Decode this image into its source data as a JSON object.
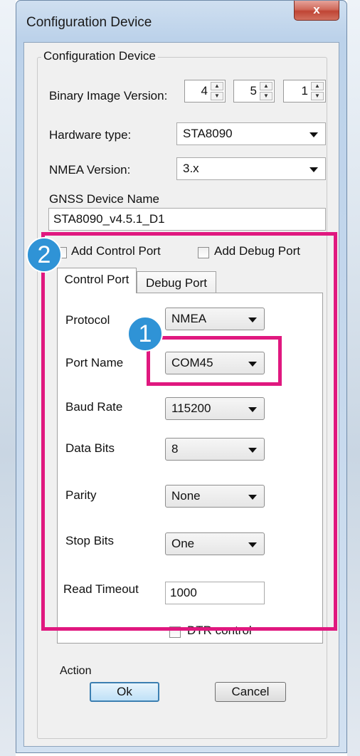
{
  "window": {
    "title": "Configuration Device",
    "close_glyph": "x"
  },
  "group": {
    "legend": "Configuration Device"
  },
  "binary_image": {
    "label": "Binary Image Version:",
    "values": [
      "4",
      "5",
      "1"
    ]
  },
  "hardware": {
    "label": "Hardware type:",
    "value": "STA8090"
  },
  "nmea": {
    "label": "NMEA Version:",
    "value": "3.x"
  },
  "gnss": {
    "label": "GNSS Device Name",
    "value": "STA8090_v4.5.1_D1"
  },
  "ports": {
    "add_control": "Add Control Port",
    "add_debug": "Add Debug Port"
  },
  "tabs": {
    "control": "Control Port",
    "debug": "Debug Port"
  },
  "control_port": {
    "protocol": {
      "label": "Protocol",
      "value": "NMEA"
    },
    "port_name": {
      "label": "Port Name",
      "value": "COM45"
    },
    "baud_rate": {
      "label": "Baud Rate",
      "value": "115200"
    },
    "data_bits": {
      "label": "Data Bits",
      "value": "8"
    },
    "parity": {
      "label": "Parity",
      "value": "None"
    },
    "stop_bits": {
      "label": "Stop Bits",
      "value": "One"
    },
    "read_timeout": {
      "label": "Read Timeout",
      "value": "1000"
    },
    "dtr": {
      "label": "DTR control"
    }
  },
  "action": {
    "legend": "Action",
    "ok": "Ok",
    "cancel": "Cancel"
  },
  "callouts": {
    "one": "1",
    "two": "2"
  },
  "colors": {
    "highlight": "#e0187f",
    "badge": "#2f93d6"
  }
}
